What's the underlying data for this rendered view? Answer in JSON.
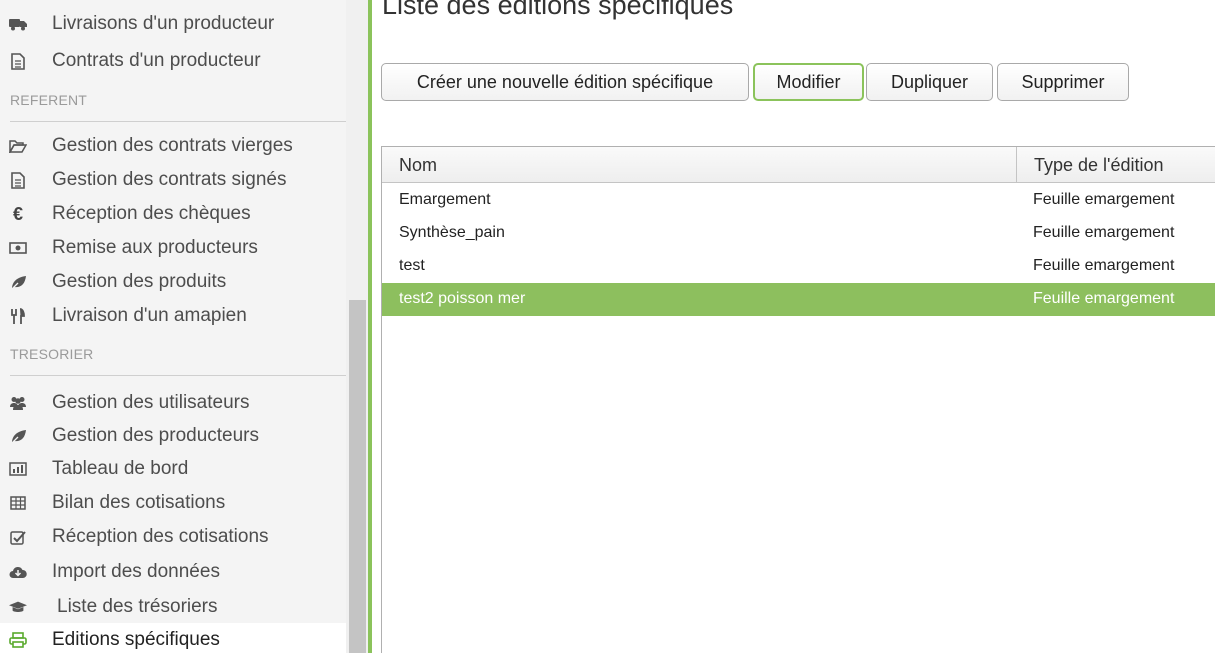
{
  "page": {
    "title": "Liste des éditions spécifiques"
  },
  "sidebar": {
    "items_top": [
      {
        "label": "Livraisons d'un producteur",
        "icon": "truck-icon"
      },
      {
        "label": "Contrats d'un producteur",
        "icon": "file-text-icon"
      }
    ],
    "sections": [
      {
        "header": "REFERENT",
        "items": [
          {
            "label": "Gestion des contrats vierges",
            "icon": "folder-open-icon"
          },
          {
            "label": "Gestion des contrats signés",
            "icon": "file-text-icon"
          },
          {
            "label": "Réception des chèques",
            "icon": "euro-icon"
          },
          {
            "label": "Remise aux producteurs",
            "icon": "money-icon"
          },
          {
            "label": "Gestion des produits",
            "icon": "leaf-icon"
          },
          {
            "label": "Livraison d'un amapien",
            "icon": "cutlery-icon"
          }
        ]
      },
      {
        "header": "TRESORIER",
        "items": [
          {
            "label": "Gestion des utilisateurs",
            "icon": "users-icon"
          },
          {
            "label": "Gestion des producteurs",
            "icon": "leaf-icon"
          },
          {
            "label": "Tableau de bord",
            "icon": "bar-chart-icon"
          },
          {
            "label": "Bilan des cotisations",
            "icon": "table-icon"
          },
          {
            "label": "Réception des cotisations",
            "icon": "check-square-icon"
          },
          {
            "label": "Import des données",
            "icon": "cloud-download-icon"
          },
          {
            "label": "Liste des trésoriers",
            "icon": "graduation-cap-icon"
          },
          {
            "label": "Editions spécifiques",
            "icon": "print-icon",
            "active": true
          }
        ]
      }
    ]
  },
  "toolbar": {
    "create_label": "Créer une nouvelle édition spécifique",
    "modify_label": "Modifier",
    "duplicate_label": "Dupliquer",
    "delete_label": "Supprimer"
  },
  "table": {
    "columns": [
      "Nom",
      "Type de l'édition"
    ],
    "rows": [
      {
        "name": "Emargement",
        "type": "Feuille emargement",
        "selected": false
      },
      {
        "name": "Synthèse_pain",
        "type": "Feuille emargement",
        "selected": false
      },
      {
        "name": "test",
        "type": "Feuille emargement",
        "selected": false
      },
      {
        "name": "test2 poisson mer",
        "type": "Feuille emargement",
        "selected": true
      }
    ]
  },
  "colors": {
    "accent_green": "#8bc35b",
    "selected_row": "#8dbf5e",
    "active_icon": "#5aaa2d"
  }
}
